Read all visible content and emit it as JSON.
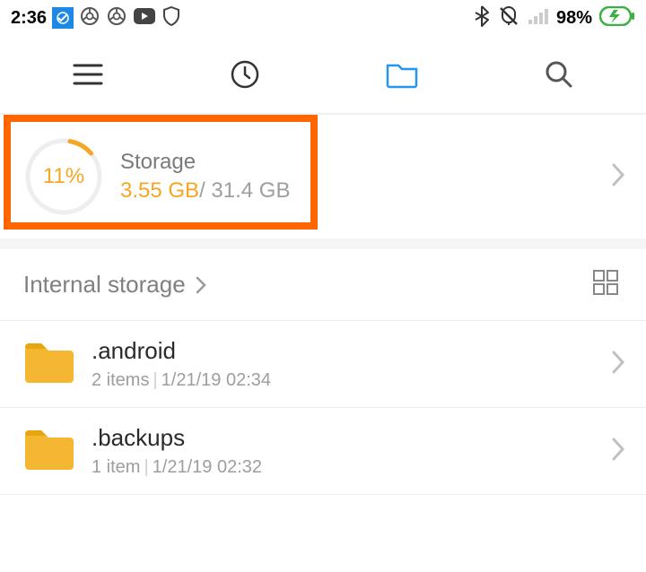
{
  "status": {
    "time": "2:36",
    "battery_pct": "98%"
  },
  "storage": {
    "title": "Storage",
    "percent": "11%",
    "used": "3.55 GB",
    "total": "/ 31.4 GB"
  },
  "breadcrumb": {
    "label": "Internal storage"
  },
  "folders": [
    {
      "name": ".android",
      "items": "2 items",
      "date": "1/21/19 02:34"
    },
    {
      "name": ".backups",
      "items": "1 item",
      "date": "1/21/19 02:32"
    }
  ]
}
